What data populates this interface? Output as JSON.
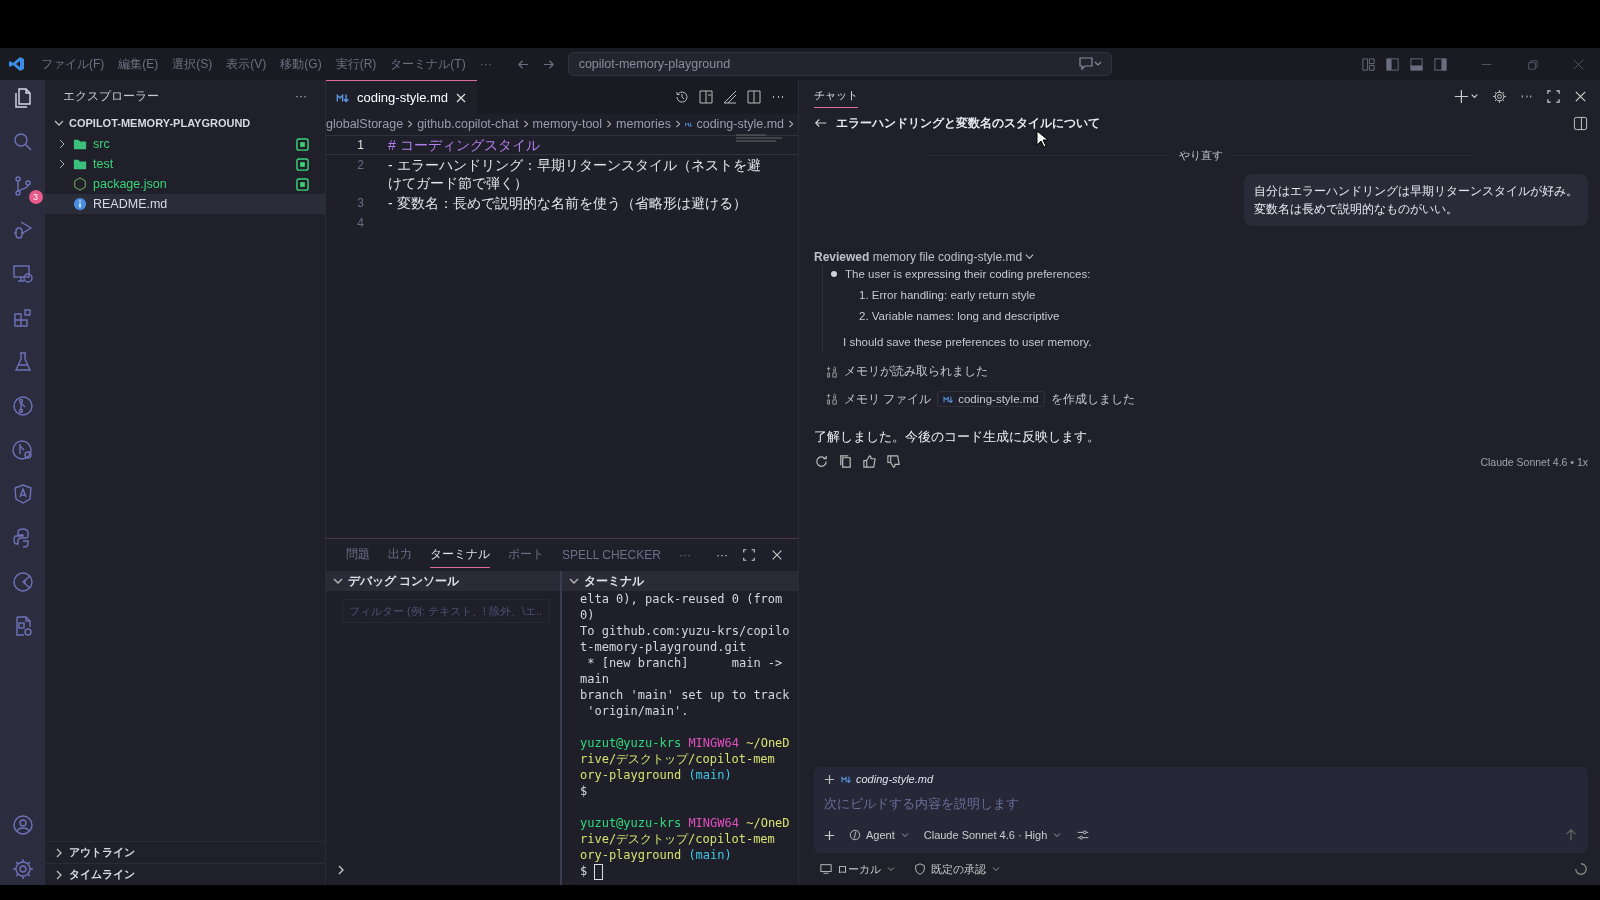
{
  "title_bar": {
    "menu": [
      "ファイル(F)",
      "編集(E)",
      "選択(S)",
      "表示(V)",
      "移動(G)",
      "実行(R)",
      "ターミナル(T)",
      "···"
    ],
    "search": "copilot-memory-playground"
  },
  "activity_bar": {
    "items": [
      {
        "kind": "files",
        "selected": true
      },
      {
        "kind": "search",
        "selected": false
      },
      {
        "kind": "scm",
        "selected": false,
        "badge": "3"
      },
      {
        "kind": "debug",
        "selected": false
      },
      {
        "kind": "remote",
        "selected": false
      },
      {
        "kind": "extensions",
        "selected": false
      },
      {
        "kind": "testing",
        "selected": false
      },
      {
        "kind": "git-graph",
        "selected": false
      },
      {
        "kind": "git-search",
        "selected": false
      },
      {
        "kind": "angular",
        "selected": false
      },
      {
        "kind": "python",
        "selected": false
      },
      {
        "kind": "pie",
        "selected": false
      },
      {
        "kind": "file-gear",
        "selected": false
      }
    ],
    "bottom": [
      {
        "kind": "account",
        "selected": false
      },
      {
        "kind": "settings",
        "selected": false
      }
    ]
  },
  "sidebar": {
    "title": "エクスプローラー",
    "more": "···",
    "root": "COPILOT-MEMORY-PLAYGROUND",
    "root_expanded": true,
    "items": [
      {
        "name": "src",
        "kind": "folder",
        "expanded": false,
        "untracked": true,
        "selected": false
      },
      {
        "name": "test",
        "kind": "folder",
        "expanded": false,
        "untracked": true,
        "selected": false
      },
      {
        "name": "package.json",
        "kind": "json",
        "untracked": true,
        "selected": false
      },
      {
        "name": "README.md",
        "kind": "info",
        "untracked": false,
        "selected": true
      }
    ],
    "sections": [
      {
        "label": "アウトライン",
        "expanded": false
      },
      {
        "label": "タイムライン",
        "expanded": false
      }
    ]
  },
  "editor": {
    "tabs": [
      {
        "label": "coding-style.md",
        "selected": true
      }
    ],
    "breadcrumb": [
      "globalStorage",
      "github.copilot-chat",
      "memory-tool",
      "memories",
      "coding-style.md"
    ],
    "lines": [
      {
        "number": "1",
        "kind": "heading",
        "text": "# コーディングスタイル",
        "active": true
      },
      {
        "number": "2",
        "kind": "list",
        "text": "- エラーハンドリング：早期リターンスタイル（ネストを避けてガード節で弾く）",
        "active": false
      },
      {
        "number": "3",
        "kind": "list",
        "text": "- 変数名：長めで説明的な名前を使う（省略形は避ける）",
        "active": false
      },
      {
        "number": "4",
        "kind": "blank",
        "active": false
      }
    ]
  },
  "panel": {
    "tabs": [
      {
        "label": "問題",
        "selected": false
      },
      {
        "label": "出力",
        "selected": false
      },
      {
        "label": "ターミナル",
        "selected": true
      },
      {
        "label": "ポート",
        "selected": false
      },
      {
        "label": "SPELL CHECKER",
        "selected": false
      },
      {
        "label": "···",
        "selected": false
      }
    ],
    "more": "···",
    "debug_console": {
      "title": "デバッグ コンソール",
      "expanded": true,
      "filter_placeholder": "フィルター (例: テキスト、! 除外、\\エ..."
    },
    "terminal": {
      "title": "ターミナル",
      "expanded": true,
      "lines": [
        {
          "spaced": false,
          "segments": [
            {
              "kind": "plain",
              "text": "elta 0), pack-reused 0 (from"
            }
          ]
        },
        {
          "spaced": false,
          "segments": [
            {
              "kind": "plain",
              "text": "0)"
            }
          ]
        },
        {
          "spaced": false,
          "segments": [
            {
              "kind": "plain",
              "text": "To github.com:yuzu-krs/copilo"
            }
          ]
        },
        {
          "spaced": false,
          "segments": [
            {
              "kind": "plain",
              "text": "t-memory-playground.git"
            }
          ]
        },
        {
          "spaced": false,
          "segments": [
            {
              "kind": "plain",
              "text": " * [new branch]      main ->"
            }
          ]
        },
        {
          "spaced": false,
          "segments": [
            {
              "kind": "plain",
              "text": "main"
            }
          ]
        },
        {
          "spaced": false,
          "segments": [
            {
              "kind": "plain",
              "text": "branch 'main' set up to track"
            }
          ]
        },
        {
          "spaced": false,
          "segments": [
            {
              "kind": "plain",
              "text": " 'origin/main'."
            }
          ]
        },
        {
          "spaced": true,
          "segments": [
            {
              "kind": "user",
              "text": "yuzut@yuzu-krs"
            },
            {
              "kind": "host",
              "text": "MINGW64"
            },
            {
              "kind": "path",
              "text": "~/OneD"
            }
          ]
        },
        {
          "spaced": false,
          "segments": [
            {
              "kind": "path",
              "text": "rive/デスクトップ/copilot-mem"
            }
          ]
        },
        {
          "spaced": false,
          "segments": [
            {
              "kind": "path",
              "text": "ory-playground"
            },
            {
              "kind": "branch",
              "text": "(main)"
            }
          ]
        },
        {
          "spaced": false,
          "segments": [
            {
              "kind": "plain",
              "text": "$"
            }
          ]
        },
        {
          "spaced": true,
          "segments": [
            {
              "kind": "user",
              "text": "yuzut@yuzu-krs"
            },
            {
              "kind": "host",
              "text": "MINGW64"
            },
            {
              "kind": "path",
              "text": "~/OneD"
            }
          ]
        },
        {
          "spaced": false,
          "segments": [
            {
              "kind": "path",
              "text": "rive/デスクトップ/copilot-mem"
            }
          ]
        },
        {
          "spaced": false,
          "segments": [
            {
              "kind": "path",
              "text": "ory-playground"
            },
            {
              "kind": "branch",
              "text": "(main)"
            }
          ]
        },
        {
          "spaced": false,
          "cursor": true,
          "segments": [
            {
              "kind": "plain",
              "text": "$"
            }
          ]
        }
      ]
    }
  },
  "chat": {
    "tabs": [
      {
        "label": "チャット",
        "selected": true
      }
    ],
    "title": "エラーハンドリングと変数名のスタイルについて",
    "divider": "やり直す",
    "user_message": [
      "自分はエラーハンドリングは早期リターンスタイルが好み。",
      "変数名は長めで説明的なものがいい。"
    ],
    "thinking": {
      "header": "**Reviewed** memory file coding-style.md",
      "expanded": true,
      "bullet": "The user is expressing their coding preferences:",
      "items": [
        "1. Error handling: early return style",
        "2. Variable names: long and descriptive"
      ],
      "conclusion": "I should save these preferences to user memory."
    },
    "tool_calls": [
      {
        "kind": "plain",
        "text": "メモリが読み取られました"
      },
      {
        "kind": "file",
        "before": "メモリ ファイル",
        "file": "coding-style.md",
        "after": "を作成しました"
      }
    ],
    "response": "了解しました。今後のコード生成に反映します。",
    "model_label": "Claude Sonnet 4.6 • 1x",
    "input": {
      "attachment": "coding-style.md",
      "placeholder": "次にビルドする内容を説明します",
      "mode": "Agent",
      "model": "Claude Sonnet 4.6 · High"
    },
    "footer": [
      {
        "kind": "local",
        "label": "ローカル"
      },
      {
        "kind": "approval",
        "label": "既定の承認"
      }
    ]
  }
}
